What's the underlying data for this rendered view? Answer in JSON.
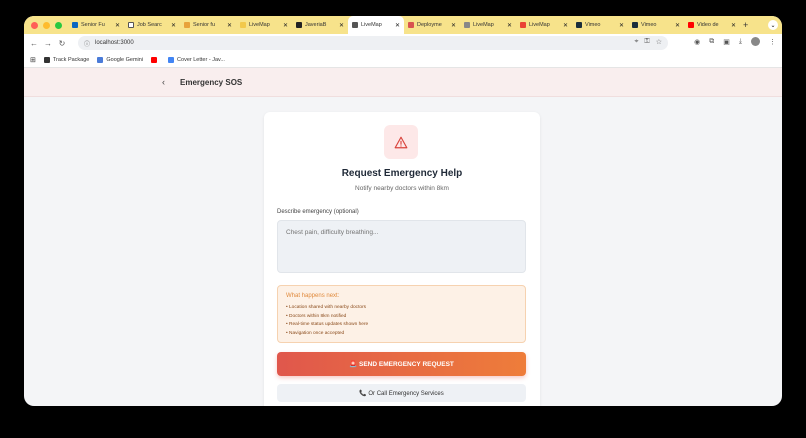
{
  "browser": {
    "tabs": [
      {
        "label": "Senior Fu",
        "icon_color": "#0a66c2",
        "icon": "linkedin-icon"
      },
      {
        "label": "Job Searc",
        "icon_color": "#ffffff",
        "icon": "info-icon"
      },
      {
        "label": "Senior fu",
        "icon_color": "#e8a33c",
        "icon": "site-icon"
      },
      {
        "label": "LiveMap",
        "icon_color": "#f2c94c",
        "icon": "site-icon"
      },
      {
        "label": "JaveriaB",
        "icon_color": "#222222",
        "icon": "github-icon"
      },
      {
        "label": "LiveMap",
        "icon_color": "#555555",
        "icon": "globe-icon",
        "active": true
      },
      {
        "label": "Deployme",
        "icon_color": "#d9534f",
        "icon": "site-icon"
      },
      {
        "label": "LiveMap",
        "icon_color": "#888888",
        "icon": "globe-icon"
      },
      {
        "label": "LiveMap",
        "icon_color": "#ea4335",
        "icon": "gmail-icon"
      },
      {
        "label": "Vimeo",
        "icon_color": "#1a2e3b",
        "icon": "vimeo-icon"
      },
      {
        "label": "Vimeo",
        "icon_color": "#1a2e3b",
        "icon": "vimeo-icon"
      },
      {
        "label": "Video de",
        "icon_color": "#ff0000",
        "icon": "youtube-icon"
      }
    ],
    "url": "localhost:3000",
    "bookmarks": [
      {
        "label": "Track Package",
        "icon_color": "#333333"
      },
      {
        "label": "Google Gemini",
        "icon_color": "#4a7bd8"
      },
      {
        "label": "",
        "icon_color": "#ff0000"
      },
      {
        "label": "Cover Letter - Jav...",
        "icon_color": "#4285f4"
      }
    ]
  },
  "app": {
    "header_title": "Emergency SOS",
    "back_glyph": "‹",
    "title": "Request Emergency Help",
    "subtitle": "Notify nearby doctors within 8km",
    "description_label": "Describe emergency (optional)",
    "description_placeholder": "Chest pain, difficulty breathing...",
    "info_title": "What happens next:",
    "info_items": [
      "• Location shared with nearby doctors",
      "• Doctors within 8km notified",
      "• Real-time status updates shown here",
      "• Navigation once accepted"
    ],
    "sos_button": "🚨 SEND EMERGENCY REQUEST",
    "call_button": "📞 Or Call Emergency Services",
    "accent": "#e0574c",
    "accent2": "#ee7d3a"
  }
}
